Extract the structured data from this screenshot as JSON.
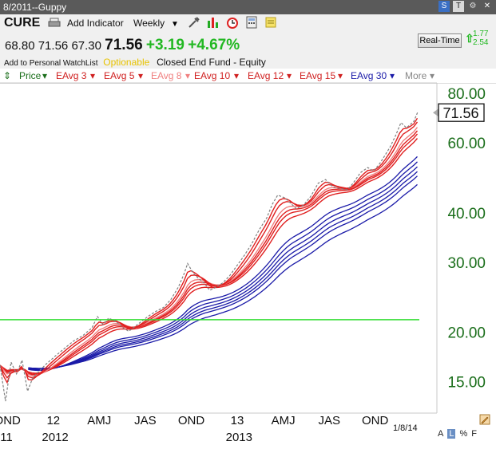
{
  "window": {
    "title": "8/2011--Guppy",
    "controls": [
      "S",
      "T",
      "⚙",
      "✕"
    ]
  },
  "toolbar": {
    "symbol": "CURE",
    "add_indicator": "Add Indicator",
    "period": "Weekly"
  },
  "quote": {
    "open": "68.80",
    "high": "71.56",
    "low": "67.30",
    "last": "71.56",
    "change": "+3.19",
    "change_pct": "+4.67%"
  },
  "info": {
    "watchlist": "Add to Personal WatchList",
    "optionable": "Optionable",
    "type": "Closed End Fund - Equity"
  },
  "realtime": {
    "label": "Real-Time",
    "values": [
      "1.77",
      "2.54"
    ]
  },
  "legend": [
    "Price",
    "EAvg 3",
    "EAvg 5",
    "EAvg 8",
    "EAvg 10",
    "EAvg 12",
    "EAvg 15",
    "EAvg 30",
    "More"
  ],
  "status": {
    "date": "1/8/14",
    "scale_options": [
      "A",
      "L",
      "%",
      "F"
    ]
  },
  "colors": {
    "price": "#808080",
    "short_avgs": "#e02020",
    "ema8": "#f08080",
    "long_avgs": "#1a1aa8",
    "reference_line": "#33dd33",
    "axis_text": "#1a6e1a"
  },
  "chart_data": {
    "type": "line",
    "title": "",
    "scale": "log",
    "ylim": [
      12.5,
      85
    ],
    "y_ticks": [
      80,
      60,
      40,
      30,
      20,
      15
    ],
    "y_tick_labels": [
      "80.00",
      "60.00",
      "40.00",
      "30.00",
      "20.00",
      "15.00"
    ],
    "last_value": 71.56,
    "last_value_label": "71.56",
    "horizontal_line": 21.5,
    "x_period_labels": [
      "OND",
      "12",
      "AMJ",
      "JAS",
      "OND",
      "13",
      "AMJ",
      "JAS",
      "OND"
    ],
    "x_year_labels": [
      "11",
      "2012",
      "2013"
    ],
    "price": [
      [
        2011.75,
        16.5
      ],
      [
        2011.78,
        13.4
      ],
      [
        2011.81,
        16.8
      ],
      [
        2011.84,
        15.7
      ],
      [
        2011.87,
        17.0
      ],
      [
        2011.9,
        14.2
      ],
      [
        2011.93,
        15.4
      ],
      [
        2011.96,
        15.9
      ],
      [
        2012.0,
        16.6
      ],
      [
        2012.05,
        17.4
      ],
      [
        2012.1,
        18.2
      ],
      [
        2012.15,
        19.0
      ],
      [
        2012.2,
        19.6
      ],
      [
        2012.25,
        20.5
      ],
      [
        2012.28,
        21.9
      ],
      [
        2012.31,
        20.9
      ],
      [
        2012.34,
        21.7
      ],
      [
        2012.38,
        21.3
      ],
      [
        2012.42,
        20.5
      ],
      [
        2012.45,
        20.1
      ],
      [
        2012.48,
        20.6
      ],
      [
        2012.52,
        21.3
      ],
      [
        2012.56,
        22.0
      ],
      [
        2012.6,
        22.6
      ],
      [
        2012.64,
        23.1
      ],
      [
        2012.68,
        24.2
      ],
      [
        2012.72,
        26.0
      ],
      [
        2012.75,
        28.0
      ],
      [
        2012.77,
        29.8
      ],
      [
        2012.8,
        28.2
      ],
      [
        2012.83,
        27.3
      ],
      [
        2012.86,
        26.6
      ],
      [
        2012.89,
        25.5
      ],
      [
        2012.92,
        25.9
      ],
      [
        2012.96,
        26.6
      ],
      [
        2013.0,
        27.8
      ],
      [
        2013.04,
        29.5
      ],
      [
        2013.08,
        31.3
      ],
      [
        2013.12,
        33.5
      ],
      [
        2013.16,
        36.3
      ],
      [
        2013.2,
        38.8
      ],
      [
        2013.23,
        42.0
      ],
      [
        2013.26,
        44.3
      ],
      [
        2013.3,
        43.6
      ],
      [
        2013.33,
        42.3
      ],
      [
        2013.36,
        41.0
      ],
      [
        2013.4,
        41.8
      ],
      [
        2013.44,
        44.0
      ],
      [
        2013.48,
        47.5
      ],
      [
        2013.52,
        48.5
      ],
      [
        2013.56,
        46.5
      ],
      [
        2013.6,
        46.0
      ],
      [
        2013.64,
        45.7
      ],
      [
        2013.67,
        47.5
      ],
      [
        2013.71,
        50.5
      ],
      [
        2013.75,
        52.0
      ],
      [
        2013.78,
        51.0
      ],
      [
        2013.81,
        52.8
      ],
      [
        2013.84,
        55.5
      ],
      [
        2013.87,
        58.5
      ],
      [
        2013.9,
        62.5
      ],
      [
        2013.93,
        67.5
      ],
      [
        2013.96,
        65.5
      ],
      [
        2014.0,
        68.0
      ],
      [
        2014.02,
        71.56
      ]
    ]
  }
}
